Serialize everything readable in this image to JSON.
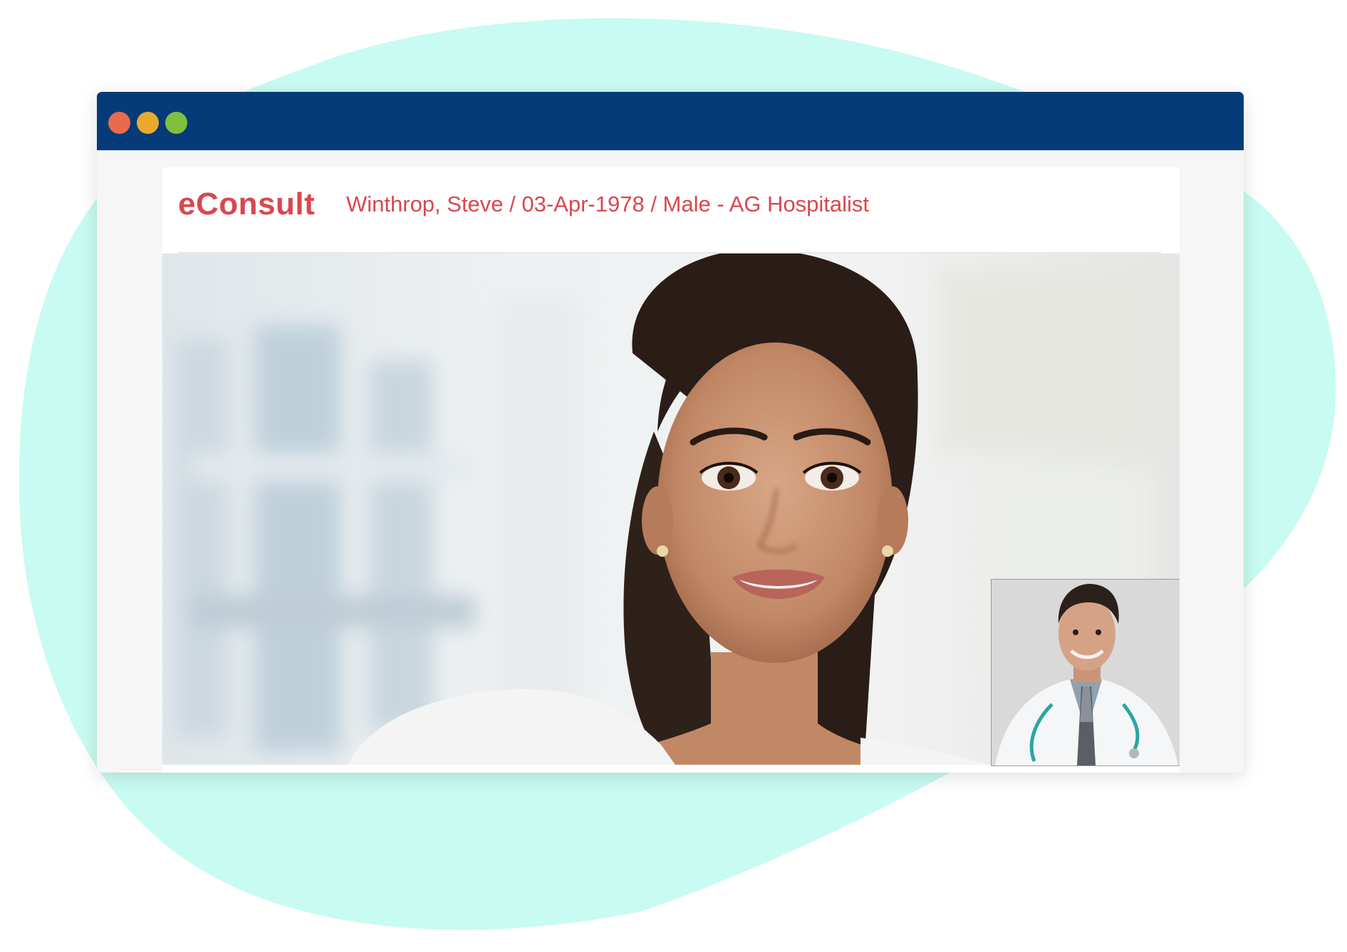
{
  "window": {
    "controls": [
      "close",
      "minimize",
      "maximize"
    ],
    "colors": {
      "titlebar": "#063b79",
      "close": "#e96b4c",
      "minimize": "#eaa82f",
      "maximize": "#7ec13e"
    }
  },
  "header": {
    "brand": "eConsult",
    "patient_info": "Winthrop, Steve / 03-Apr-1978 / Male   -  AG Hospitalist",
    "accent_color": "#d9474f"
  },
  "video": {
    "main_feed": "patient-video-feed",
    "self_view": "doctor-self-view"
  },
  "colors": {
    "background_blob": "#c8fbf1"
  }
}
